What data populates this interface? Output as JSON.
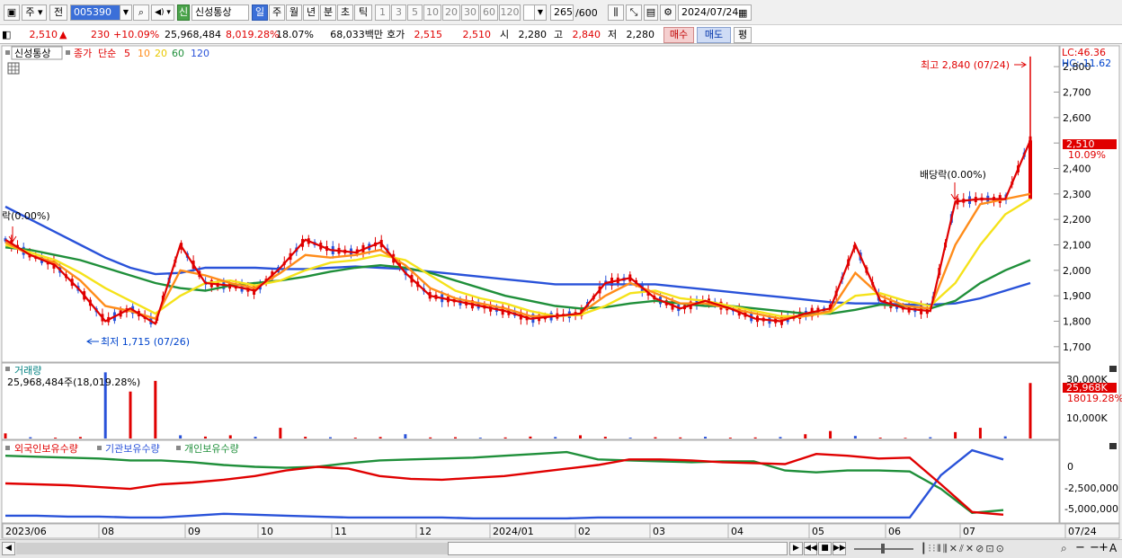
{
  "toolbar": {
    "period_menu": "주",
    "prev_label": "전",
    "code": "005390",
    "badge": "신",
    "stock_name": "신성통상",
    "tf_day": "일",
    "tf_week": "주",
    "tf_month": "월",
    "tf_year": "년",
    "tf_min": "분",
    "tf_sec": "초",
    "tf_tick": "틱",
    "n1": "1",
    "n3": "3",
    "n5": "5",
    "n10": "10",
    "n20": "20",
    "n30": "30",
    "n60": "60",
    "n120": "120",
    "count": "265",
    "count_total": "/600",
    "date": "2024/07/24"
  },
  "info": {
    "price": "2,510",
    "change": "230",
    "change_pct": "+10.09%",
    "volume": "25,968,484",
    "vol_ratio": "8,019.28%",
    "turnover": "18.07%",
    "amount": "68,033백만",
    "quote_label": "호가",
    "ask": "2,515",
    "bid": "2,510",
    "open_label": "시",
    "open": "2,280",
    "high_label": "고",
    "high": "2,840",
    "low_label": "저",
    "low": "2,280",
    "buy": "매수",
    "sell": "매도",
    "eval": "평"
  },
  "chart_data": {
    "type": "line",
    "legend": {
      "name": "신성통상",
      "close": "종가",
      "ma_type": "단순",
      "ma": [
        "5",
        "10",
        "20",
        "60",
        "120"
      ]
    },
    "ma_colors": {
      "ma5": "#e00000",
      "ma10": "#ff8c1a",
      "ma20": "#f5e21a",
      "ma60": "#1f8f3a",
      "ma120": "#2952d9"
    },
    "price_axis": [
      "2,800",
      "2,700",
      "2,600",
      "2,500",
      "2,400",
      "2,300",
      "2,200",
      "2,100",
      "2,000",
      "1,900",
      "1,800",
      "1,700"
    ],
    "ylim": [
      1650,
      2850
    ],
    "lc": "LC:46.36",
    "hc": "HC:-11.62",
    "last_price": "2,510",
    "last_pct": "10.09%",
    "high_ann": "최고 2,840 (07/24)",
    "low_ann": "최저 1,715 (07/26)",
    "div_ann": "배당락(0.00%)",
    "left_ann": "락(0.00%)",
    "x_labels": [
      "2023/06",
      "08",
      "09",
      "10",
      "11",
      "12",
      "2024/01",
      "02",
      "03",
      "04",
      "05",
      "06",
      "07",
      "07/24"
    ],
    "ma5": [
      2120,
      2060,
      2020,
      1920,
      1800,
      1850,
      1790,
      2100,
      1950,
      1940,
      1920,
      2010,
      2120,
      2080,
      2070,
      2110,
      1990,
      1900,
      1880,
      1860,
      1840,
      1810,
      1820,
      1830,
      1950,
      1970,
      1890,
      1850,
      1880,
      1850,
      1810,
      1800,
      1830,
      1850,
      2100,
      1880,
      1850,
      1840,
      2270,
      2280,
      2280,
      2510
    ],
    "ma10": [
      2110,
      2060,
      2030,
      1960,
      1860,
      1840,
      1810,
      2000,
      1980,
      1950,
      1930,
      1990,
      2060,
      2050,
      2060,
      2080,
      2020,
      1930,
      1890,
      1870,
      1850,
      1820,
      1820,
      1830,
      1900,
      1950,
      1910,
      1870,
      1870,
      1850,
      1830,
      1810,
      1820,
      1840,
      1990,
      1900,
      1860,
      1850,
      2100,
      2260,
      2280,
      2300
    ],
    "ma20": [
      2100,
      2070,
      2040,
      1990,
      1930,
      1880,
      1830,
      1900,
      1950,
      1960,
      1940,
      1960,
      2000,
      2030,
      2040,
      2060,
      2040,
      1980,
      1920,
      1890,
      1870,
      1840,
      1820,
      1825,
      1860,
      1910,
      1920,
      1890,
      1880,
      1860,
      1840,
      1820,
      1820,
      1835,
      1900,
      1910,
      1880,
      1860,
      1950,
      2100,
      2220,
      2280
    ],
    "ma60": [
      2090,
      2080,
      2060,
      2040,
      2010,
      1980,
      1950,
      1930,
      1920,
      1940,
      1950,
      1960,
      1975,
      1995,
      2010,
      2020,
      2010,
      1990,
      1960,
      1930,
      1900,
      1880,
      1860,
      1850,
      1855,
      1870,
      1880,
      1870,
      1860,
      1860,
      1850,
      1840,
      1830,
      1830,
      1845,
      1865,
      1860,
      1850,
      1880,
      1950,
      2000,
      2040
    ],
    "ma120": [
      2250,
      2200,
      2150,
      2100,
      2050,
      2010,
      1985,
      1990,
      2010,
      2010,
      2010,
      2005,
      2005,
      2010,
      2015,
      2010,
      2005,
      1995,
      1985,
      1975,
      1965,
      1955,
      1945,
      1945,
      1945,
      1945,
      1945,
      1935,
      1925,
      1915,
      1905,
      1895,
      1885,
      1875,
      1870,
      1870,
      1865,
      1865,
      1870,
      1890,
      1920,
      1950
    ],
    "vol_label": "거래량",
    "vol_value": "25,968,484주(18,019.28%)",
    "vol_axis": [
      "30,000K",
      "10,000K"
    ],
    "vol_last": "25,968K",
    "vol_last_pct": "18019.28%",
    "vol_spikes_k": [
      2400,
      600,
      400,
      700,
      31000,
      22000,
      27000,
      1500,
      900,
      1500,
      800,
      5000,
      800,
      600,
      400,
      700,
      2000,
      500,
      600,
      400,
      500,
      900,
      700,
      1500,
      800,
      400,
      600,
      500,
      800,
      400,
      500,
      700,
      2000,
      3500,
      1200,
      400,
      300,
      600,
      3000,
      5000,
      1000,
      26000
    ],
    "hold_labels": {
      "foreign": "외국인보유수량",
      "inst": "기관보유수량",
      "indiv": "개인보유수량"
    },
    "hold_axis": [
      "0",
      "-2,500,000",
      "-5,000,000"
    ],
    "foreign_hold": [
      -2.4,
      -2.5,
      -2.6,
      -2.8,
      -3.0,
      -2.5,
      -2.3,
      -2.0,
      -1.6,
      -1.0,
      -0.6,
      -0.8,
      -1.6,
      -1.9,
      -2.0,
      -1.8,
      -1.6,
      -1.2,
      -0.8,
      -0.4,
      0.2,
      0.2,
      0.1,
      -0.1,
      -0.2,
      -0.3,
      0.8,
      0.6,
      0.3,
      0.4,
      -2.5,
      -5.5,
      -5.8
    ],
    "inst_hold": [
      -5.9,
      -5.9,
      -6.0,
      -6.0,
      -6.1,
      -6.1,
      -5.9,
      -5.7,
      -5.8,
      -5.9,
      -6.0,
      -6.1,
      -6.1,
      -6.1,
      -6.1,
      -6.2,
      -6.2,
      -6.2,
      -6.2,
      -6.1,
      -6.1,
      -6.1,
      -6.1,
      -6.1,
      -6.1,
      -6.1,
      -6.1,
      -6.1,
      -6.1,
      -6.1,
      -1.5,
      1.2,
      0.2
    ],
    "indiv_hold": [
      0.6,
      0.5,
      0.4,
      0.3,
      0.1,
      0.1,
      -0.1,
      -0.4,
      -0.6,
      -0.7,
      -0.6,
      -0.2,
      0.1,
      0.2,
      0.3,
      0.4,
      0.6,
      0.8,
      1.0,
      0.2,
      0.1,
      0.0,
      -0.1,
      0.0,
      0.0,
      -1.0,
      -1.2,
      -1.0,
      -1.0,
      -1.1,
      -3.0,
      -5.6,
      -5.3
    ]
  }
}
